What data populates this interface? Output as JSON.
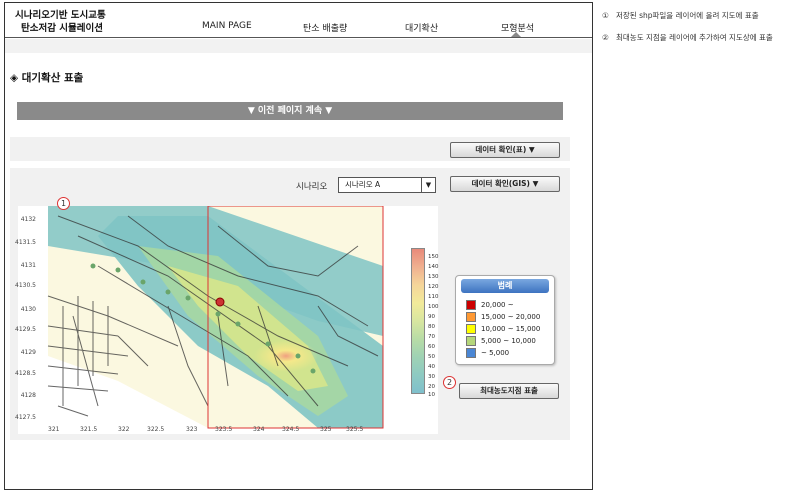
{
  "app": {
    "title_line1": "시나리오기반 도시교통",
    "title_line2": "탄소저감 시뮬레이션"
  },
  "nav": [
    "MAIN PAGE",
    "탄소 배출량",
    "대기확산",
    "모형분석"
  ],
  "active_nav": "모형분석",
  "section_title": "◈ 대기확산 표출",
  "prev_page_bar": "▼ 이전 페이지 계속 ▼",
  "buttons": {
    "data_table": "데이터 확인(표) ▼",
    "data_gis": "데이터 확인(GIS) ▼",
    "max_point": "최대농도지점 표출"
  },
  "scenario": {
    "label": "시나리오",
    "value": "시나리오 A"
  },
  "map": {
    "y_ticks": [
      "4132",
      "4131.5",
      "4131",
      "4130.5",
      "4130",
      "4129.5",
      "4129",
      "4128.5",
      "4128",
      "4127.5"
    ],
    "x_ticks": [
      "321",
      "321.5",
      "322",
      "322.5",
      "323",
      "323.5",
      "324",
      "324.5",
      "325",
      "325.5"
    ],
    "colorbar_values": [
      "150",
      "140",
      "130",
      "120",
      "110",
      "100",
      "90",
      "80",
      "70",
      "60",
      "50",
      "40",
      "30",
      "20",
      "10"
    ]
  },
  "legend": {
    "title": "범례",
    "items": [
      {
        "label": "20,000 ~",
        "color": "#cc0000"
      },
      {
        "label": "15,000 ~ 20,000",
        "color": "#ff9933"
      },
      {
        "label": "10,000 ~ 15,000",
        "color": "#ffff00"
      },
      {
        "label": "5,000 ~ 10,000",
        "color": "#b5d67a"
      },
      {
        "label": "~ 5,000",
        "color": "#4a86d4"
      }
    ]
  },
  "markers": {
    "one": "1",
    "two": "2"
  },
  "notes": [
    {
      "num": "①",
      "text": "저장된 shp파일을 레이어에 올려 지도에 표출"
    },
    {
      "num": "②",
      "text": "최대농도 지점을 레이어에 추가하여 지도상에 표출"
    }
  ]
}
